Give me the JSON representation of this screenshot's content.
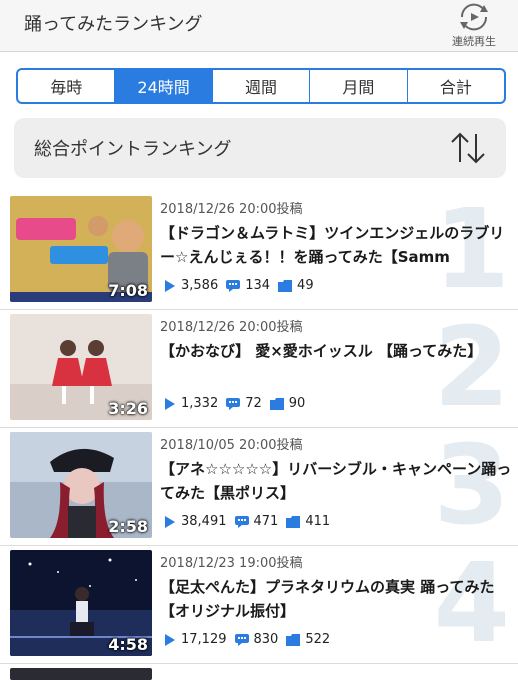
{
  "header": {
    "title": "踊ってみたランキング",
    "loop_label": "連続再生"
  },
  "tabs": [
    {
      "label": "毎時",
      "active": false
    },
    {
      "label": "24時間",
      "active": true
    },
    {
      "label": "週間",
      "active": false
    },
    {
      "label": "月間",
      "active": false
    },
    {
      "label": "合計",
      "active": false
    }
  ],
  "sort": {
    "title": "総合ポイントランキング"
  },
  "rankings": [
    {
      "rank": "1",
      "date": "2018/12/26 20:00投稿",
      "title": "【ドラゴン＆ムラトミ】ツインエンジェルのラブリー☆えんじぇる！！を踊ってみた【Samm",
      "duration": "7:08",
      "views": "3,586",
      "comments": "134",
      "mylists": "49"
    },
    {
      "rank": "2",
      "date": "2018/12/26 20:00投稿",
      "title": "【かおなび】 愛×愛ホイッスル 【踊ってみた】",
      "duration": "3:26",
      "views": "1,332",
      "comments": "72",
      "mylists": "90"
    },
    {
      "rank": "3",
      "date": "2018/10/05 20:00投稿",
      "title": "【アネ☆☆☆☆☆】リバーシブル・キャンペーン踊ってみた【黒ポリス】",
      "duration": "2:58",
      "views": "38,491",
      "comments": "471",
      "mylists": "411"
    },
    {
      "rank": "4",
      "date": "2018/12/23 19:00投稿",
      "title": "【足太ぺんた】プラネタリウムの真実 踊ってみた【オリジナル振付】",
      "duration": "4:58",
      "views": "17,129",
      "comments": "830",
      "mylists": "522"
    }
  ],
  "colors": {
    "accent": "#2a7ce0",
    "rank_number": "#e4ebf1"
  }
}
